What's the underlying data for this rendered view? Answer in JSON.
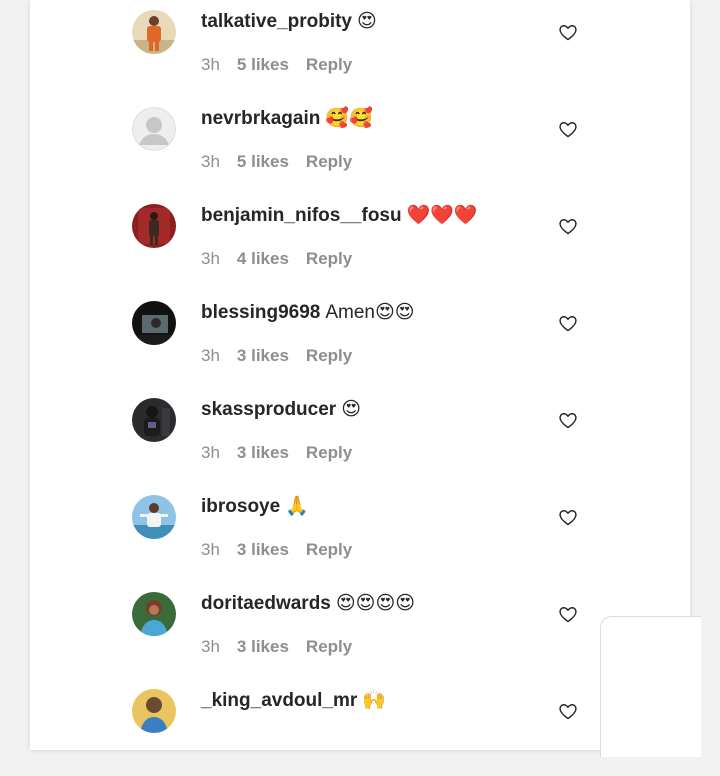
{
  "comments": [
    {
      "username": "talkative_probity",
      "text": "😍",
      "time": "3h",
      "likes": "5 likes",
      "reply": "Reply",
      "avatar": "orange-figure-avatar"
    },
    {
      "username": "nevrbrkagain",
      "text": "🥰🥰",
      "time": "3h",
      "likes": "5 likes",
      "reply": "Reply",
      "avatar": "default-avatar"
    },
    {
      "username": "benjamin_nifos__fosu",
      "text": "❤️❤️❤️",
      "time": "3h",
      "likes": "4 likes",
      "reply": "Reply",
      "avatar": "red-background-avatar"
    },
    {
      "username": "blessing9698",
      "text": "Amen😍😍",
      "time": "3h",
      "likes": "3 likes",
      "reply": "Reply",
      "avatar": "dark-avatar"
    },
    {
      "username": "skassproducer",
      "text": "😍",
      "time": "3h",
      "likes": "3 likes",
      "reply": "Reply",
      "avatar": "dark-avatar"
    },
    {
      "username": "ibrosoye",
      "text": "🙏",
      "time": "3h",
      "likes": "3 likes",
      "reply": "Reply",
      "avatar": "sky-avatar"
    },
    {
      "username": "doritaedwards",
      "text": "😍😍😍😍",
      "time": "3h",
      "likes": "3 likes",
      "reply": "Reply",
      "avatar": "green-avatar"
    },
    {
      "username": "_king_avdoul_mr",
      "text": "🙌",
      "time": "",
      "likes": "",
      "reply": "",
      "avatar": "blue-avatar"
    }
  ],
  "colors": {
    "text": "#262626",
    "meta": "#8e8e8e",
    "background": "#f2f2f2",
    "panel": "#ffffff"
  }
}
